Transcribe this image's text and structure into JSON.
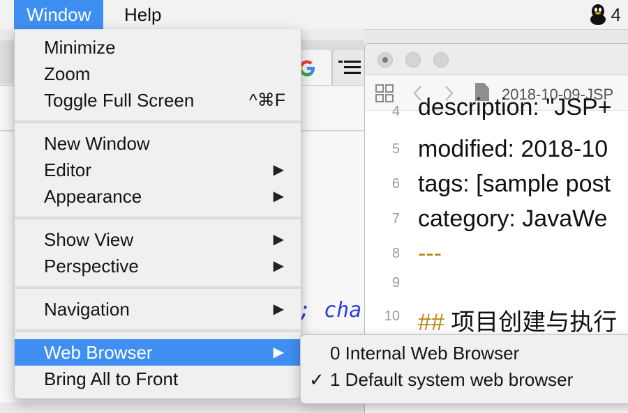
{
  "menubar": {
    "window_label": "Window",
    "help_label": "Help",
    "status_icon": "qq-penguin-icon",
    "status_text": "4"
  },
  "background": {
    "code_fragment": "; cha"
  },
  "editor": {
    "breadcrumb": "2018-10-09-JSP",
    "lines": [
      {
        "num": "4",
        "text": "description: \"JSP+"
      },
      {
        "num": "5",
        "text": "modified: 2018-10"
      },
      {
        "num": "6",
        "text": "tags: [sample post"
      },
      {
        "num": "7",
        "text": "category: JavaWe"
      },
      {
        "num": "8",
        "text": "---"
      },
      {
        "num": "9",
        "text": ""
      },
      {
        "num": "10",
        "hash": "##",
        "text": " 项目创建与执行"
      }
    ]
  },
  "window_menu": {
    "minimize": "Minimize",
    "zoom": "Zoom",
    "toggle_full_screen": "Toggle Full Screen",
    "toggle_full_screen_shortcut": "^⌘F",
    "new_window": "New Window",
    "editor": "Editor",
    "appearance": "Appearance",
    "show_view": "Show View",
    "perspective": "Perspective",
    "navigation": "Navigation",
    "web_browser": "Web Browser",
    "bring_all_to_front": "Bring All to Front",
    "submenu_arrow": "▶"
  },
  "web_browser_submenu": {
    "items": [
      {
        "label": "0 Internal Web Browser",
        "checked": false
      },
      {
        "label": "1 Default system web browser",
        "checked": true
      }
    ],
    "checkmark": "✓"
  }
}
